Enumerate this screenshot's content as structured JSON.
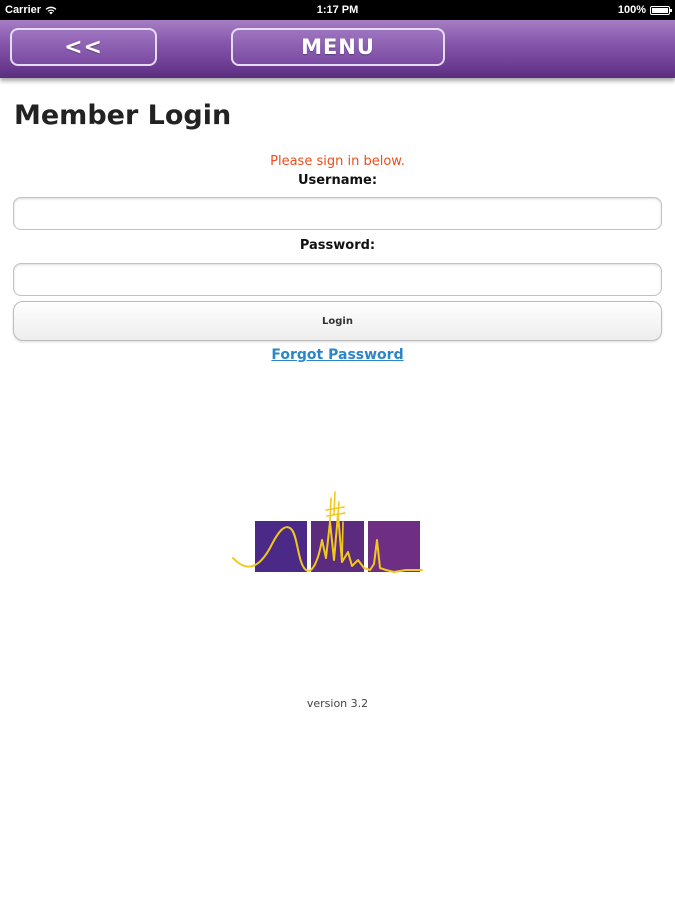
{
  "status_bar": {
    "carrier": "Carrier",
    "time": "1:17 PM",
    "battery": "100%",
    "icons": [
      "wifi-icon",
      "battery-icon"
    ]
  },
  "nav": {
    "back_label": "<<",
    "menu_label": "MENU"
  },
  "page": {
    "title": "Member Login",
    "message": "Please sign in below.",
    "username_label": "Username:",
    "username_value": "",
    "password_label": "Password:",
    "password_value": "",
    "login_label": "Login",
    "forgot_label": "Forgot Password",
    "version": "version 3.2"
  },
  "colors": {
    "nav_purple": "#7a4aa2",
    "message_orange": "#ee4c1a",
    "link_blue": "#2a86c9",
    "logo_gold": "#f2c81d",
    "logo_purples": [
      "#4a2a86",
      "#5b2c7e",
      "#6e2e84"
    ]
  }
}
